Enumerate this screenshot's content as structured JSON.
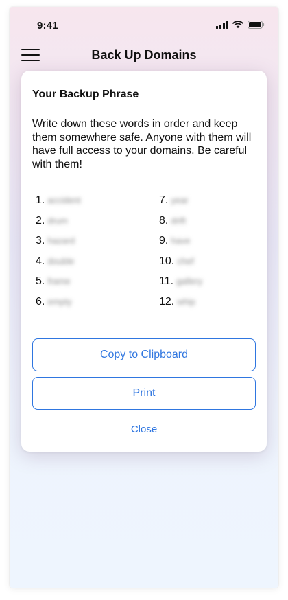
{
  "status_bar": {
    "time": "9:41"
  },
  "nav": {
    "title": "Back Up Domains",
    "menu_icon": "hamburger-menu-icon"
  },
  "modal": {
    "title": "Your Backup Phrase",
    "description": "Write down these words in order and keep them somewhere safe. Anyone with them will have full access to your domains. Be careful with them!",
    "words": [
      {
        "num": "1.",
        "word": "accident"
      },
      {
        "num": "2.",
        "word": "drum"
      },
      {
        "num": "3.",
        "word": "hazard"
      },
      {
        "num": "4.",
        "word": "double"
      },
      {
        "num": "5.",
        "word": "frame"
      },
      {
        "num": "6.",
        "word": "empty"
      },
      {
        "num": "7.",
        "word": "year"
      },
      {
        "num": "8.",
        "word": "drift"
      },
      {
        "num": "9.",
        "word": "have"
      },
      {
        "num": "10.",
        "word": "chef"
      },
      {
        "num": "11.",
        "word": "gallery"
      },
      {
        "num": "12.",
        "word": "whip"
      }
    ],
    "copy_button": "Copy to Clipboard",
    "print_button": "Print",
    "close_link": "Close"
  },
  "colors": {
    "accent": "#2f76e0",
    "text": "#111111"
  }
}
